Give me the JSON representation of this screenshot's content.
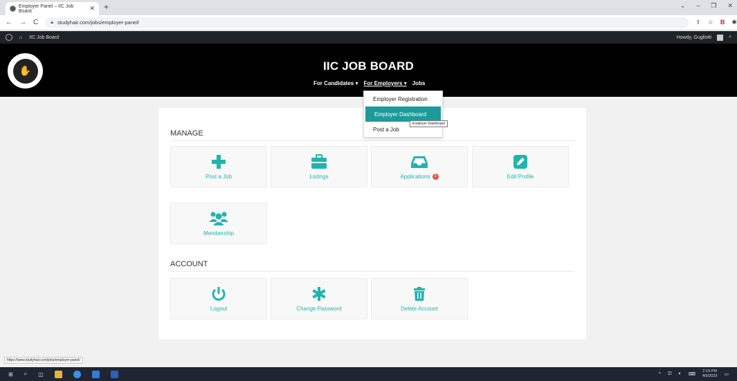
{
  "browser": {
    "tab_title": "Employer Panel – IIC Job Board",
    "url": "studyhair.com/jobs/employer-panel/",
    "status_url": "https://www.studyhair.com/jobs/employer-panel/"
  },
  "adminbar": {
    "site_name": "IIC Job Board",
    "greeting": "Howdy, Gugliotti"
  },
  "header": {
    "title": "IIC JOB BOARD",
    "logo_text": "INTERNATIONAL INSTITUTE OF COSMETOLOGY",
    "nav": [
      {
        "label": "For Candidates ▾"
      },
      {
        "label": "For Employers ▾"
      },
      {
        "label": "Jobs"
      }
    ]
  },
  "dropdown": {
    "items": [
      {
        "label": "Employer Registration"
      },
      {
        "label": "Employer Dashboard"
      },
      {
        "label": "Post a Job"
      }
    ],
    "tooltip": "Employer Dashboard"
  },
  "manage": {
    "title": "MANAGE",
    "tiles": [
      {
        "label": "Post a Job",
        "icon": "plus-icon"
      },
      {
        "label": "Listings",
        "icon": "briefcase-icon"
      },
      {
        "label": "Applications",
        "icon": "inbox-icon",
        "badge": "3"
      },
      {
        "label": "Edit Profile",
        "icon": "pencil-icon"
      },
      {
        "label": "Membership",
        "icon": "users-icon"
      }
    ]
  },
  "account": {
    "title": "ACCOUNT",
    "tiles": [
      {
        "label": "Logout",
        "icon": "power-icon"
      },
      {
        "label": "Change Password",
        "icon": "asterisk-icon"
      },
      {
        "label": "Delete Account",
        "icon": "trash-icon"
      }
    ]
  },
  "taskbar": {
    "time": "2:19 PM",
    "date": "4/5/2023"
  },
  "colors": {
    "accent": "#1fb5ad",
    "dropdown_highlight": "#1d9a9a",
    "badge": "#e8513e"
  }
}
